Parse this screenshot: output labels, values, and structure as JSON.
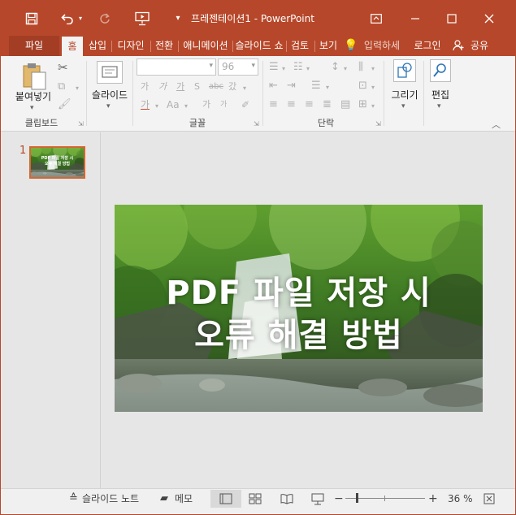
{
  "app": {
    "title": "프레젠테이션1 - PowerPoint",
    "accent": "#b7472a"
  },
  "qat": {
    "save_icon": "save-icon",
    "undo_icon": "undo-icon",
    "redo_icon": "redo-icon",
    "present_icon": "start-from-beginning-icon",
    "customize_icon": "customize-qat-icon"
  },
  "window_controls": {
    "ribbon_display": "ribbon-display-options-icon",
    "minimize": "minimize-icon",
    "maximize": "maximize-icon",
    "close": "close-icon"
  },
  "tabs": [
    "파일",
    "홈",
    "삽입",
    "디자인",
    "전환",
    "애니메이션",
    "슬라이드 쇼",
    "검토",
    "보기"
  ],
  "tellme": "입력하세",
  "signin": "로그인",
  "share": "공유",
  "ribbon": {
    "clipboard": {
      "label": "클립보드",
      "paste": "붙여넣기"
    },
    "slides": {
      "label": "",
      "new_slide": "슬라이드"
    },
    "font": {
      "label": "글꼴",
      "font_name": "",
      "font_size": "96"
    },
    "paragraph": {
      "label": "단락"
    },
    "drawing": {
      "label": "",
      "button": "그리기"
    },
    "editing": {
      "label": "",
      "button": "편집"
    }
  },
  "thumbnails": [
    {
      "number": "1",
      "line1": "PDF 파일 저장 시",
      "line2": "오류 해결 방법"
    }
  ],
  "slide": {
    "title_line1": "PDF 파일 저장 시",
    "title_line2": "오류 해결 방법",
    "background": "waterfall-forest-photo"
  },
  "status": {
    "notes": "슬라이드 노트",
    "comments": "메모",
    "zoom": "36 %"
  }
}
